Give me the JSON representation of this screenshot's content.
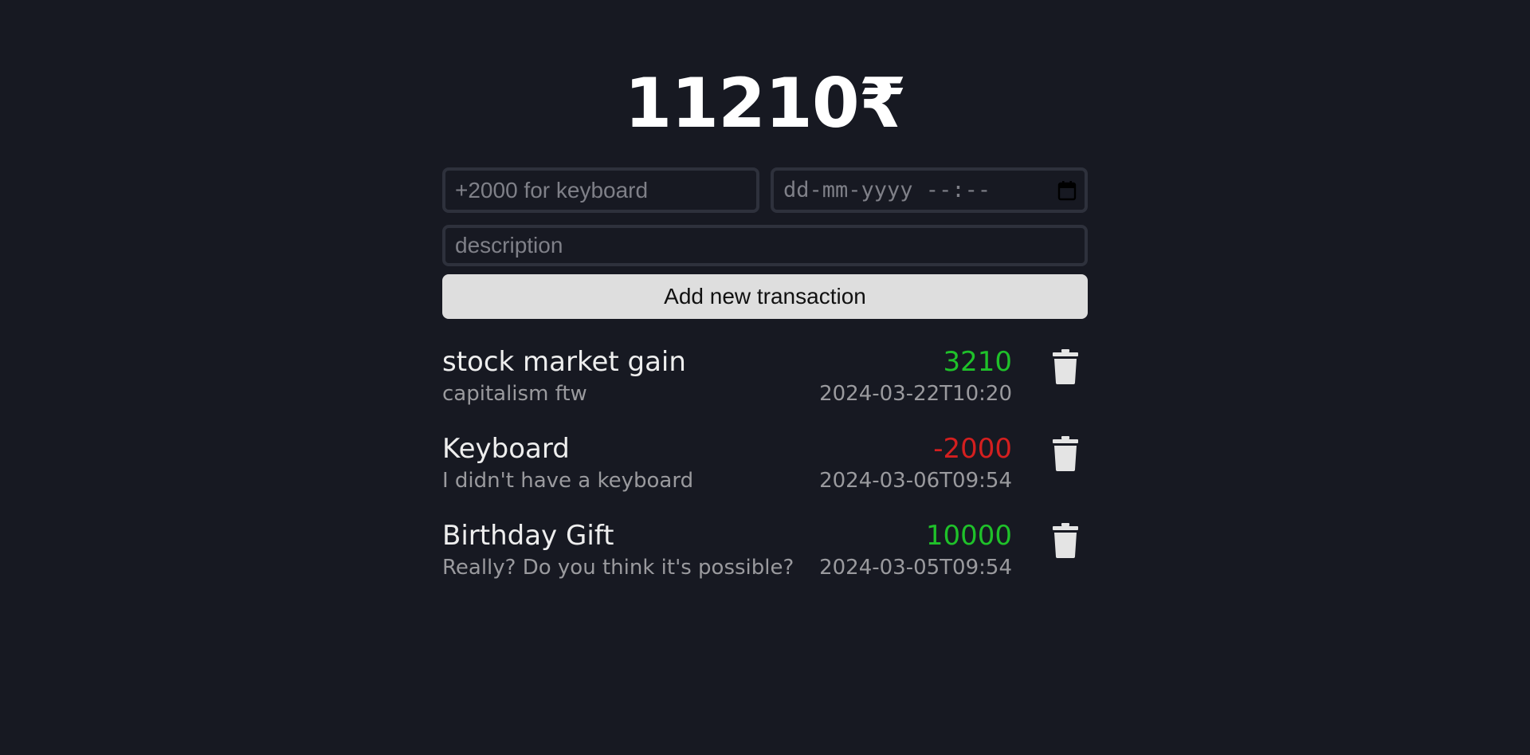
{
  "balance": "11210₹",
  "form": {
    "amount_placeholder": "+2000 for keyboard",
    "datetime_placeholder": "dd-mm-yyyy --:--",
    "description_placeholder": "description",
    "submit_label": "Add new transaction"
  },
  "icons": {
    "calendar": "calendar-icon",
    "delete": "trash-icon"
  },
  "colors": {
    "background": "#171922",
    "positive": "#1fc12a",
    "negative": "#d41f1f"
  },
  "transactions": [
    {
      "name": "stock market gain",
      "amount": "3210",
      "description": "capitalism ftw",
      "datetime": "2024-03-22T10:20"
    },
    {
      "name": "Keyboard",
      "amount": "-2000",
      "description": "I didn't have a keyboard",
      "datetime": "2024-03-06T09:54"
    },
    {
      "name": "Birthday Gift",
      "amount": "10000",
      "description": "Really? Do you think it's possible?",
      "datetime": "2024-03-05T09:54"
    }
  ]
}
